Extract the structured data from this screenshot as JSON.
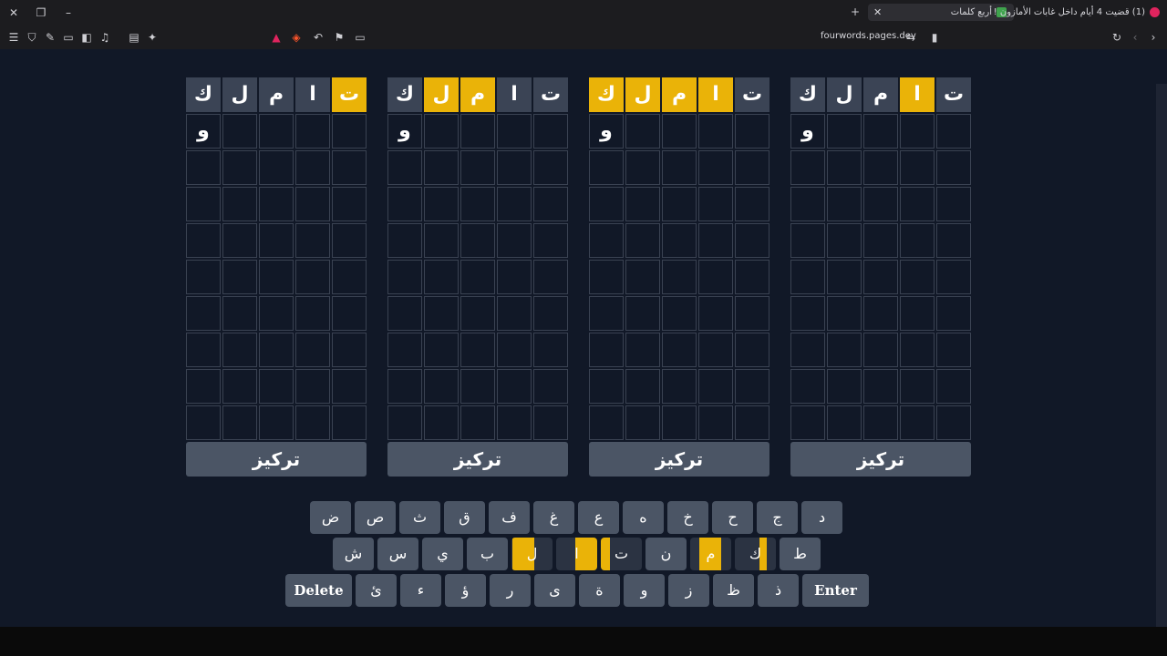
{
  "browser": {
    "tabs": [
      {
        "label": "(1) قضيت 4 أيام داخل غابات الأمازون !",
        "active": false
      },
      {
        "label": "أربع كلمات",
        "active": true
      }
    ],
    "new_tab_label": "+",
    "url": "fourwords.pages.dev"
  },
  "game": {
    "focus_label": "تركيز",
    "boards": [
      {
        "guess": [
          "ت",
          "ا",
          "م",
          "ل",
          "ك"
        ],
        "colors": [
          "yellow",
          "gray",
          "gray",
          "gray",
          "gray"
        ],
        "current": [
          "",
          "",
          "",
          "",
          "و"
        ]
      },
      {
        "guess": [
          "ت",
          "ا",
          "م",
          "ل",
          "ك"
        ],
        "colors": [
          "gray",
          "gray",
          "yellow",
          "yellow",
          "gray"
        ],
        "current": [
          "",
          "",
          "",
          "",
          "و"
        ]
      },
      {
        "guess": [
          "ت",
          "ا",
          "م",
          "ل",
          "ك"
        ],
        "colors": [
          "gray",
          "yellow",
          "yellow",
          "yellow",
          "yellow"
        ],
        "current": [
          "",
          "",
          "",
          "",
          "و"
        ]
      },
      {
        "guess": [
          "ت",
          "ا",
          "م",
          "ل",
          "ك"
        ],
        "colors": [
          "gray",
          "yellow",
          "gray",
          "gray",
          "gray"
        ],
        "current": [
          "",
          "",
          "",
          "",
          "و"
        ]
      }
    ],
    "keyboard": {
      "row1": [
        "ض",
        "ص",
        "ث",
        "ق",
        "ف",
        "غ",
        "ع",
        "ه",
        "خ",
        "ح",
        "ج",
        "د"
      ],
      "row2": [
        "ش",
        "س",
        "ي",
        "ب",
        "ل",
        "ا",
        "ت",
        "ن",
        "م",
        "ك",
        "ط"
      ],
      "row3": [
        "Delete",
        "ئ",
        "ء",
        "ؤ",
        "ر",
        "ى",
        "ة",
        "و",
        "ز",
        "ظ",
        "ذ",
        "Enter"
      ]
    },
    "colors": {
      "yellow": "#eab308",
      "gray": "#3b4455",
      "key": "#4b5565",
      "background": "#111827"
    }
  }
}
